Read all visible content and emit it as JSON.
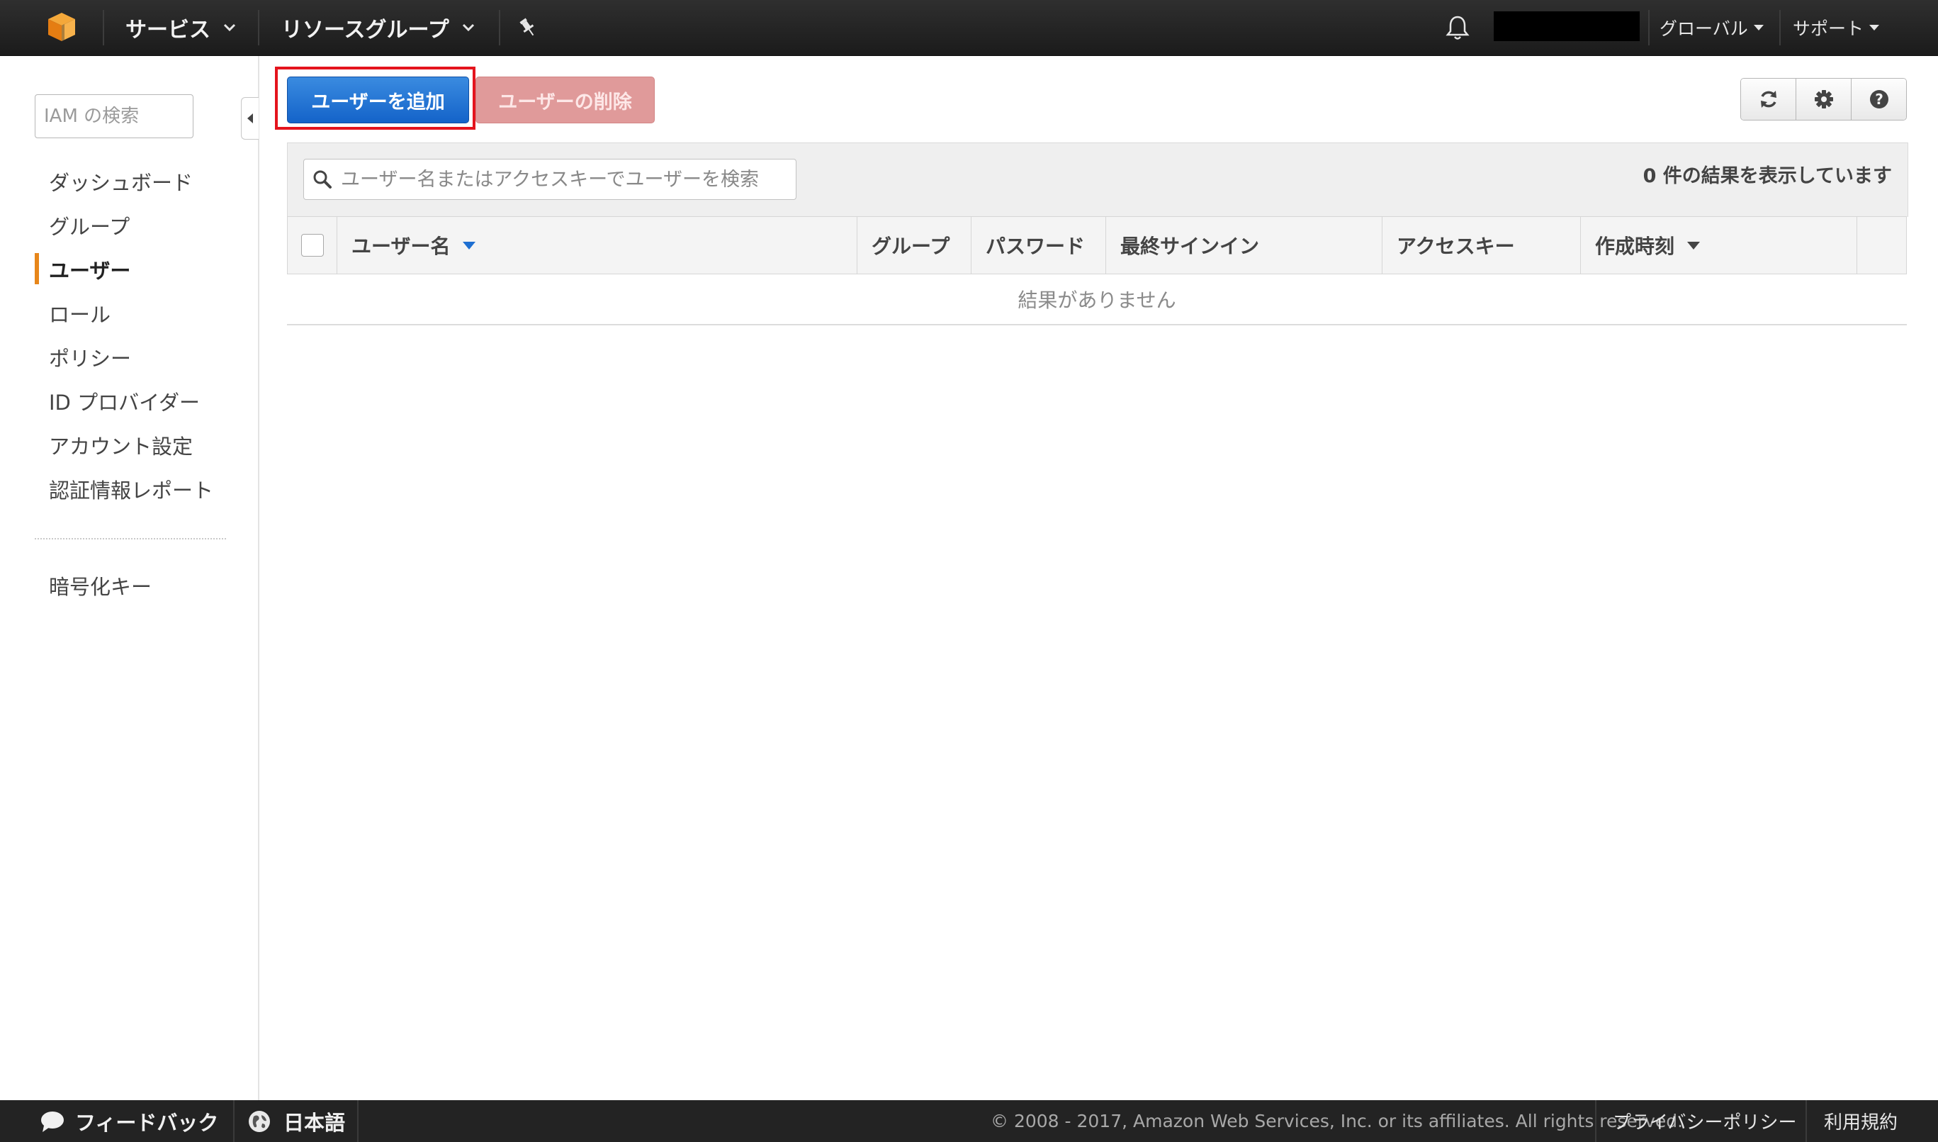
{
  "topnav": {
    "services_label": "サービス",
    "resource_groups_label": "リソースグループ",
    "region_label": "グローバル",
    "support_label": "サポート",
    "logo_icon": "aws-cube-icon",
    "pin_icon": "pin-icon",
    "bell_icon": "bell-icon"
  },
  "sidebar": {
    "search_placeholder": "IAM の検索",
    "items": [
      {
        "label": "ダッシュボード",
        "active": false
      },
      {
        "label": "グループ",
        "active": false
      },
      {
        "label": "ユーザー",
        "active": true
      },
      {
        "label": "ロール",
        "active": false
      },
      {
        "label": "ポリシー",
        "active": false
      },
      {
        "label": "ID プロバイダー",
        "active": false
      },
      {
        "label": "アカウント設定",
        "active": false
      },
      {
        "label": "認証情報レポート",
        "active": false
      }
    ],
    "extra_items": [
      {
        "label": "暗号化キー"
      }
    ]
  },
  "toolbar": {
    "add_user_label": "ユーザーを追加",
    "delete_user_label": "ユーザーの削除",
    "refresh_icon": "refresh-icon",
    "settings_icon": "gear-icon",
    "help_icon": "help-icon"
  },
  "table": {
    "search_placeholder": "ユーザー名またはアクセスキーでユーザーを検索",
    "result_count": "0 件の結果を表示しています",
    "columns": [
      "ユーザー名",
      "グループ",
      "パスワード",
      "最終サインイン",
      "アクセスキー",
      "作成時刻"
    ],
    "empty_message": "結果がありません"
  },
  "footer": {
    "feedback_label": "フィードバック",
    "language_label": "日本語",
    "copyright": "© 2008 - 2017, Amazon Web Services, Inc. or its affiliates. All rights reserved.",
    "privacy_label": "プライバシーポリシー",
    "terms_label": "利用規約"
  },
  "colors": {
    "topbar": "#232323",
    "primary_button": "#1a6fd4",
    "danger_button_disabled": "#e09a9a",
    "active_accent": "#e7861a",
    "highlight": "#e4141d"
  }
}
